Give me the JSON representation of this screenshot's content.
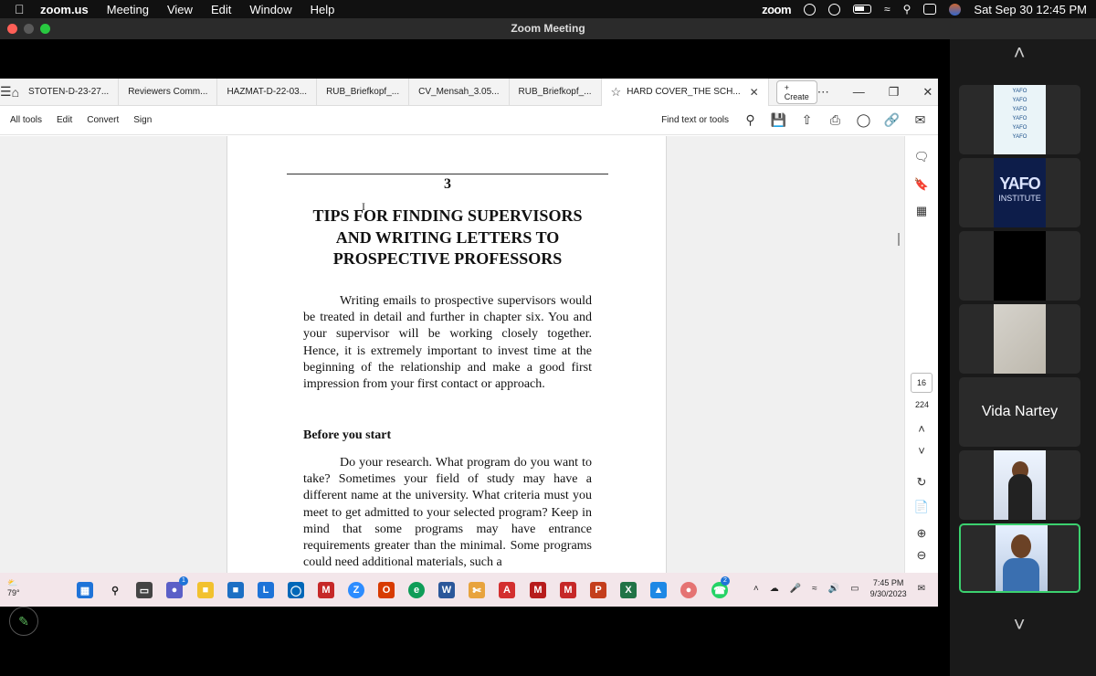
{
  "menubar": {
    "app": "zoom.us",
    "items": [
      "Meeting",
      "View",
      "Edit",
      "Window",
      "Help"
    ],
    "right_app": "zoom",
    "datetime": "Sat Sep 30  12:45 PM"
  },
  "window": {
    "title": "Zoom Meeting"
  },
  "acrobat": {
    "tabs": [
      "STOTEN-D-23-27...",
      "Reviewers Comm...",
      "HAZMAT-D-22-03...",
      "RUB_Briefkopf_...",
      "CV_Mensah_3.05...",
      "RUB_Briefkopf_..."
    ],
    "active_tab": "HARD COVER_THE SCH...",
    "create_label": "Create",
    "toolbar_menus": [
      "All tools",
      "Edit",
      "Convert",
      "Sign"
    ],
    "search_label": "Find text or tools",
    "page_current": "16",
    "page_total": "224"
  },
  "document": {
    "chapter_number": "3",
    "chapter_title_lines": [
      "TIPS FOR FINDING SUPERVISORS",
      "AND WRITING LETTERS TO",
      "PROSPECTIVE PROFESSORS"
    ],
    "paragraph1": "Writing emails to prospective supervisors would be treated in detail and further in chapter six. You and your supervisor will be working closely together. Hence, it is extremely important to invest time at the beginning of the relationship and make a good first impression from your first contact or approach.",
    "subheading": "Before you start",
    "paragraph2": "Do your research. What program do you want to take? Sometimes your field of study may have a different name at the university. What criteria must you meet to get admitted to your selected program? Keep in mind that some programs may have entrance requirements greater than the minimal. Some programs could need additional materials, such a"
  },
  "taskbar": {
    "weather": "79°",
    "time": "7:45 PM",
    "date": "9/30/2023",
    "badge_teams": "1",
    "badge_whatsapp": "2"
  },
  "participants": {
    "logo_text": "YAFO",
    "logo_sub": "INSTITUTE",
    "pattern_text": "YAFO",
    "name_tile": "Vida Nartey"
  },
  "colors": {
    "accent_blue": "#1473e6",
    "active_speaker": "#3bd16f",
    "taskbar": "#f3e6ea"
  }
}
